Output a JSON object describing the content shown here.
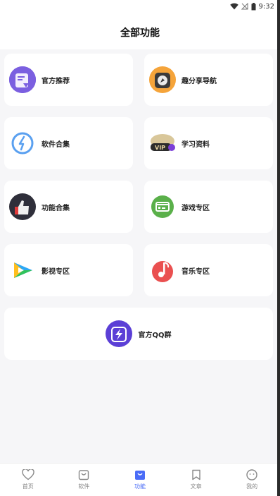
{
  "status_bar": {
    "time": "9:32"
  },
  "header": {
    "title": "全部功能"
  },
  "cards": {
    "official_recommend": "官方推荐",
    "fun_share_nav": "趣分享导航",
    "software_collection": "软件合集",
    "study_materials": "学习资料",
    "function_collection": "功能合集",
    "game_zone": "游戏专区",
    "video_zone": "影视专区",
    "music_zone": "音乐专区",
    "official_qq_group": "官方QQ群"
  },
  "tabbar": {
    "items": [
      {
        "label": "首页",
        "icon": "heart-icon"
      },
      {
        "label": "软件",
        "icon": "bag-icon"
      },
      {
        "label": "功能",
        "icon": "bag-filled-icon"
      },
      {
        "label": "文章",
        "icon": "bookmark-icon"
      },
      {
        "label": "我的",
        "icon": "smiley-icon"
      }
    ],
    "active_index": 2
  },
  "colors": {
    "accent": "#4a6cf7",
    "background": "#f6f6f8"
  }
}
